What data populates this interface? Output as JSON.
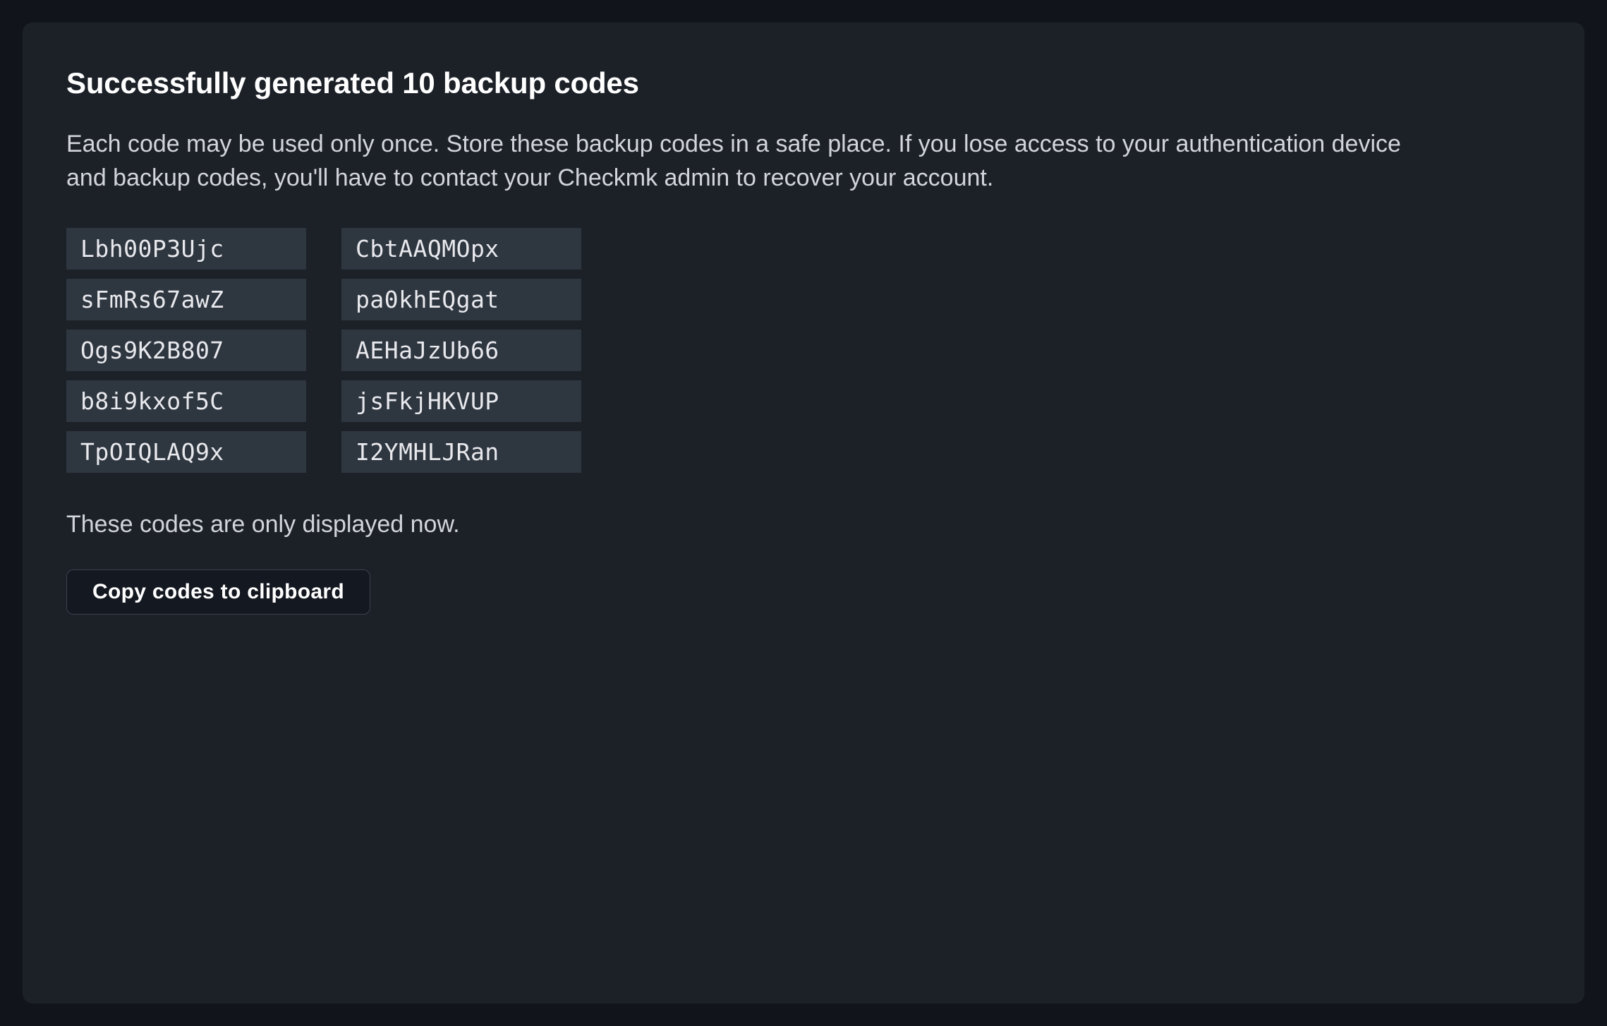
{
  "heading": "Successfully generated 10 backup codes",
  "description": "Each code may be used only once. Store these backup codes in a safe place. If you lose access to your authentication device and backup codes, you'll have to contact your Checkmk admin to recover your account.",
  "codes": {
    "r0c0": "Lbh00P3Ujc",
    "r0c1": "CbtAAQMOpx",
    "r1c0": "sFmRs67awZ",
    "r1c1": "pa0khEQgat",
    "r2c0": "Ogs9K2B807",
    "r2c1": "AEHaJzUb66",
    "r3c0": "b8i9kxof5C",
    "r3c1": "jsFkjHKVUP",
    "r4c0": "TpOIQLAQ9x",
    "r4c1": "I2YMHLJRan"
  },
  "note": "These codes are only displayed now.",
  "copy_button_label": "Copy codes to clipboard"
}
